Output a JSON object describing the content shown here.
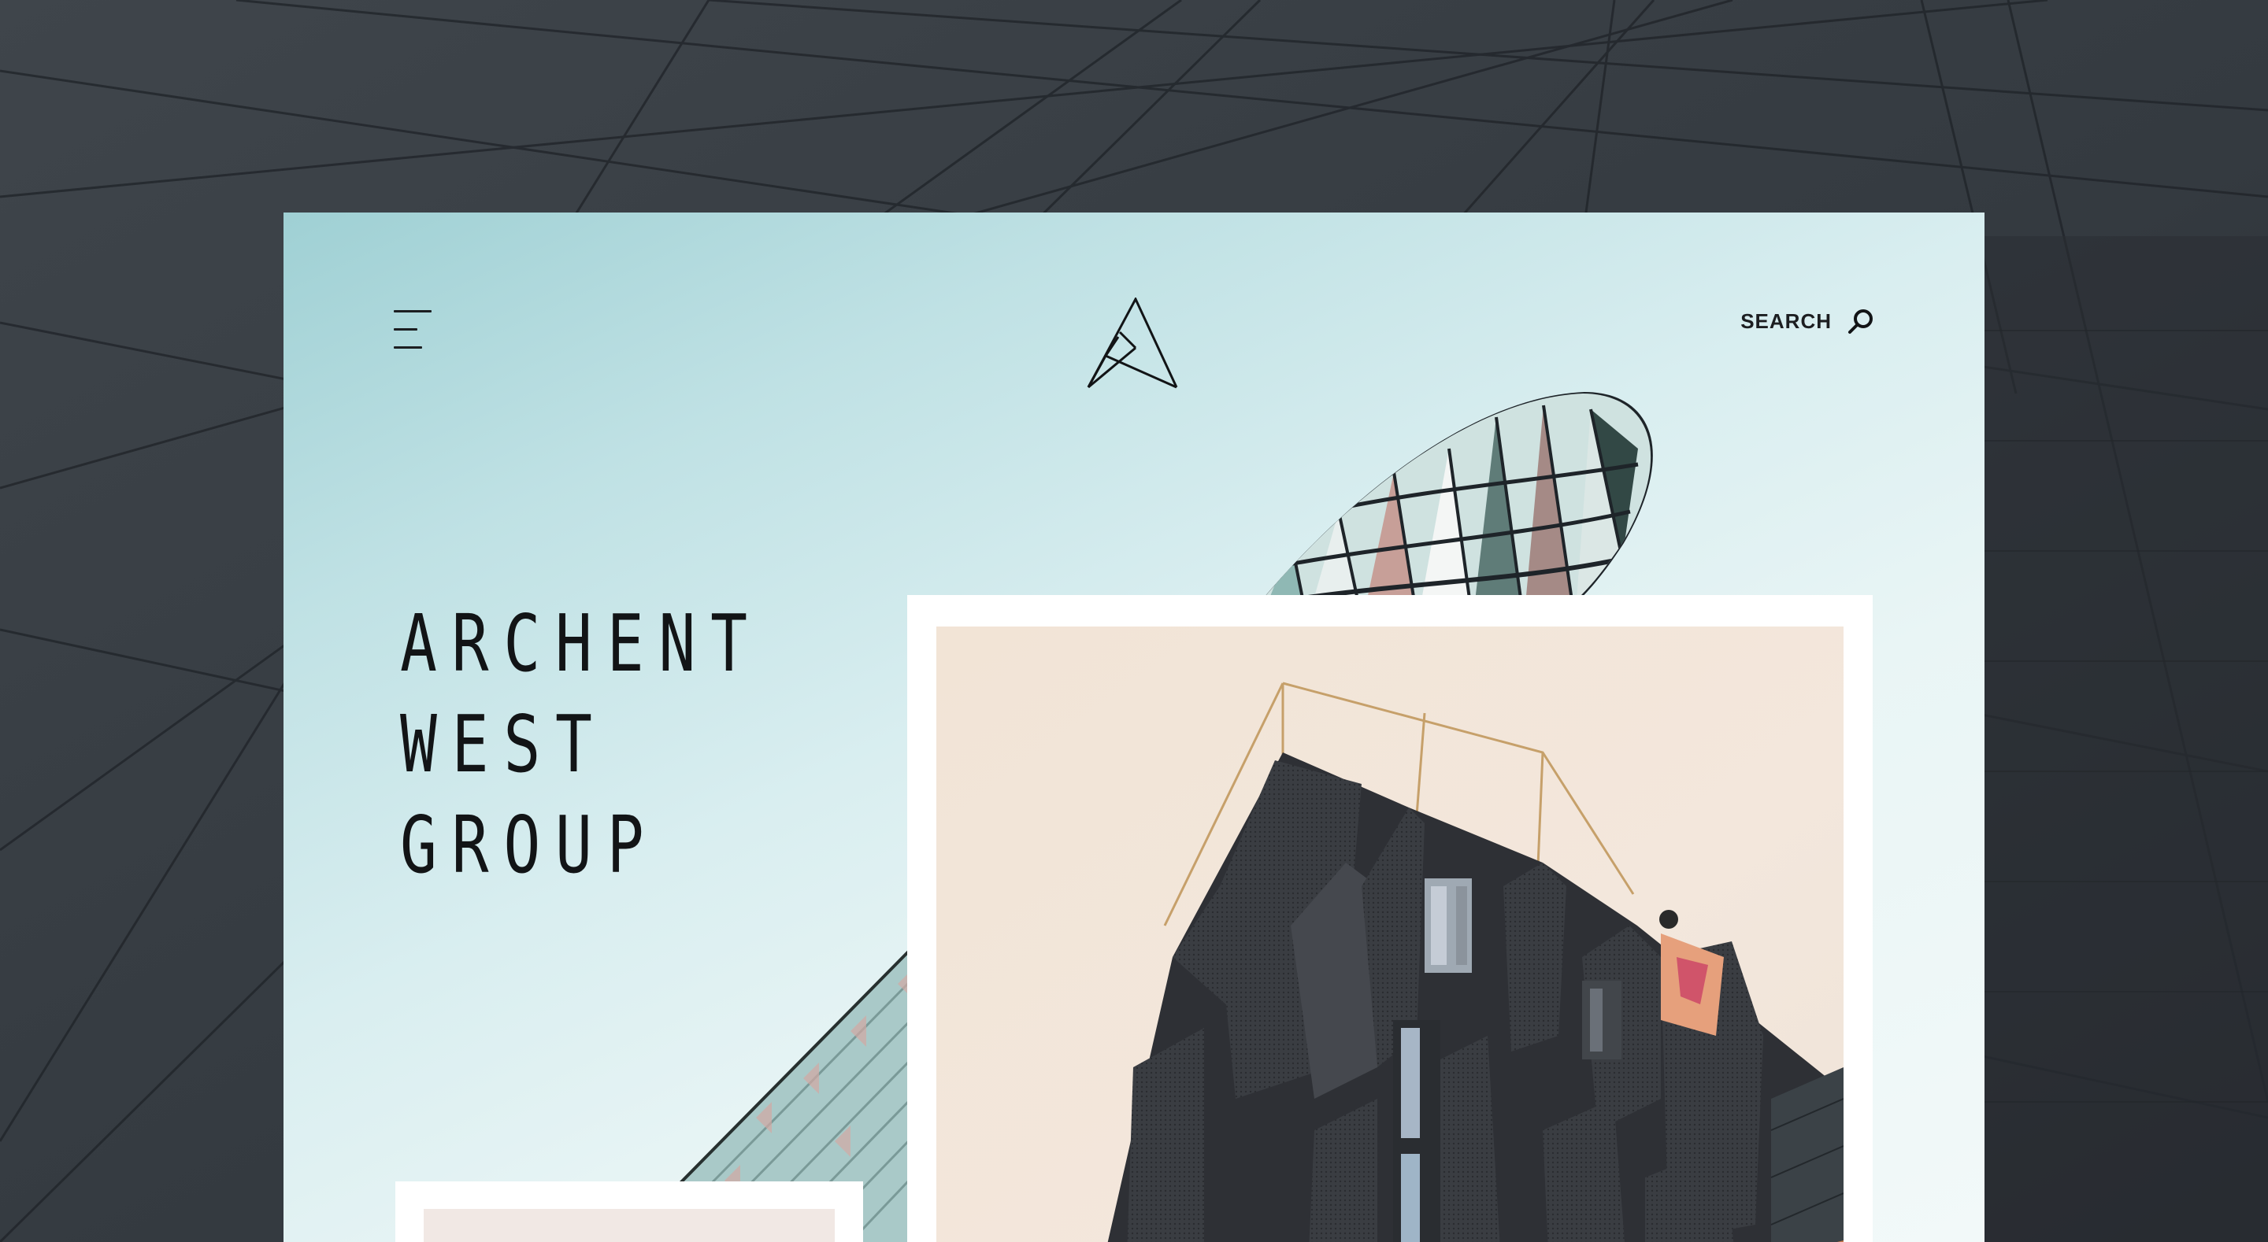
{
  "header": {
    "menu_icon": "hamburger-menu-icon",
    "logo_icon": "archent-triangle-logo-icon",
    "search_label": "SEARCH",
    "search_icon": "search-icon"
  },
  "hero": {
    "brand_lines": [
      "ARCHENT",
      "WEST",
      "GROUP"
    ]
  },
  "colors": {
    "page_background": "#33383e",
    "card_gradient_start": "#9fd0d4",
    "card_gradient_end": "#f2f9f9",
    "text": "#121416",
    "frame": "#ffffff"
  }
}
